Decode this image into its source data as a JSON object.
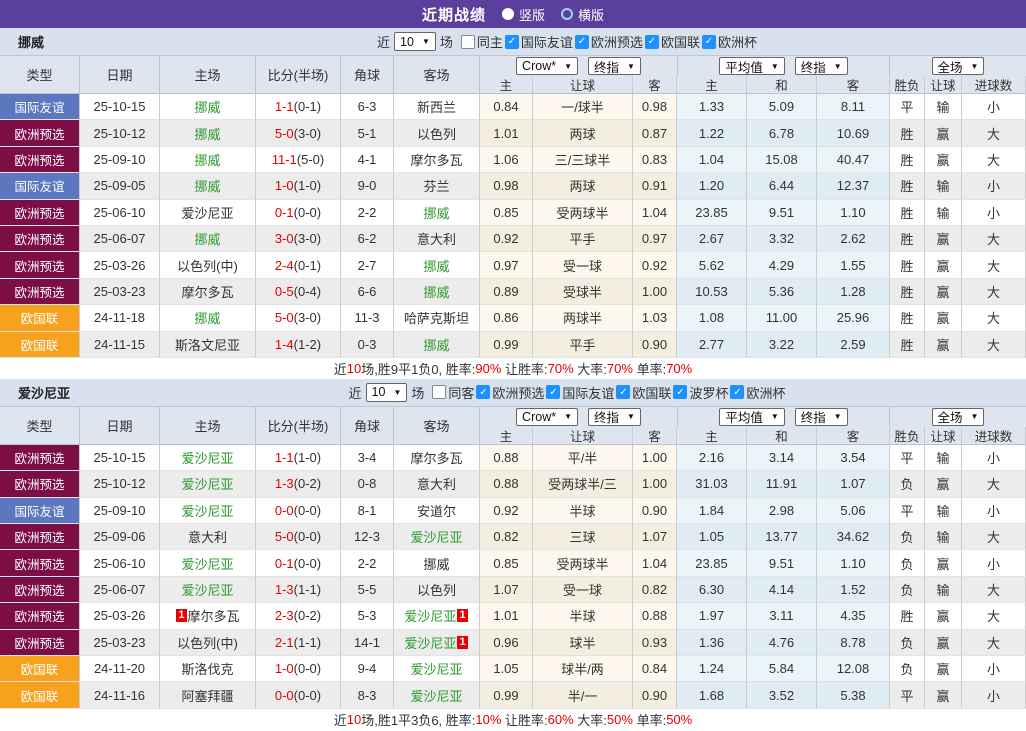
{
  "topbar": {
    "title": "近期战绩",
    "radios": [
      {
        "label": "竖版",
        "selected": true
      },
      {
        "label": "横版",
        "selected": false
      }
    ]
  },
  "thead": {
    "cols": [
      "类型",
      "日期",
      "主场",
      "比分(半场)",
      "角球",
      "客场"
    ],
    "sub": [
      "主",
      "让球",
      "客",
      "主",
      "和",
      "客",
      "胜负",
      "让球",
      "进球数"
    ],
    "dd": [
      "Crow*",
      "终指",
      "平均值",
      "终指",
      "全场"
    ]
  },
  "colors": {
    "accent_purple": "#5a3f9c",
    "type_friendly_blue": "#5a77c0",
    "type_qualifier_maroon": "#7c0d45",
    "type_nations_orange": "#f6a21d",
    "win_red": "#e00000",
    "draw_green": "#0f8a0f",
    "loss_blue": "#3232cc",
    "team_green": "#2f9a2f",
    "score_red": "#e60000"
  },
  "maps": {
    "type": {
      "国际友谊": "t-blue",
      "欧洲预选": "t-maroon",
      "欧国联": "t-orange"
    },
    "result": {
      "胜": "c-red",
      "平": "c-green",
      "负": "c-blue",
      "赢": "c-red",
      "输": "c-blue",
      "大": "c-red",
      "小": "c-blue"
    },
    "focusHome": {
      "home": "c-green2"
    },
    "focusAway": {
      "away": "c-green2"
    },
    "check": {
      "true": "on"
    },
    "radio": {
      "true": "on"
    },
    "seg": {
      "r": "s-red",
      "b": "s-blk"
    }
  },
  "sections": [
    {
      "team": "挪威",
      "filter": {
        "near": "近",
        "count": "10",
        "games": "场",
        "same": {
          "label": "同主",
          "checked": false
        },
        "comps": [
          {
            "label": "国际友谊",
            "checked": true
          },
          {
            "label": "欧洲预选",
            "checked": true
          },
          {
            "label": "欧国联",
            "checked": true
          },
          {
            "label": "欧洲杯",
            "checked": true
          }
        ]
      },
      "rows": [
        {
          "type": "国际友谊",
          "date": "25-10-15",
          "home": "挪威",
          "score": "1-1",
          "half": "(0-1)",
          "corners": "6-3",
          "away": "新西兰",
          "focus": "home",
          "h1": "0.84",
          "hcap": "一/球半",
          "h2": "0.98",
          "a1": "1.33",
          "a2": "5.09",
          "a3": "8.11",
          "wl": "平",
          "hc": "输",
          "ou": "小"
        },
        {
          "type": "欧洲预选",
          "date": "25-10-12",
          "home": "挪威",
          "score": "5-0",
          "half": "(3-0)",
          "corners": "5-1",
          "away": "以色列",
          "focus": "home",
          "h1": "1.01",
          "hcap": "两球",
          "h2": "0.87",
          "a1": "1.22",
          "a2": "6.78",
          "a3": "10.69",
          "wl": "胜",
          "hc": "赢",
          "ou": "大"
        },
        {
          "type": "欧洲预选",
          "date": "25-09-10",
          "home": "挪威",
          "score": "11-1",
          "half": "(5-0)",
          "corners": "4-1",
          "away": "摩尔多瓦",
          "focus": "home",
          "h1": "1.06",
          "hcap": "三/三球半",
          "h2": "0.83",
          "a1": "1.04",
          "a2": "15.08",
          "a3": "40.47",
          "wl": "胜",
          "hc": "赢",
          "ou": "大"
        },
        {
          "type": "国际友谊",
          "date": "25-09-05",
          "home": "挪威",
          "score": "1-0",
          "half": "(1-0)",
          "corners": "9-0",
          "away": "芬兰",
          "focus": "home",
          "h1": "0.98",
          "hcap": "两球",
          "h2": "0.91",
          "a1": "1.20",
          "a2": "6.44",
          "a3": "12.37",
          "wl": "胜",
          "hc": "输",
          "ou": "小"
        },
        {
          "type": "欧洲预选",
          "date": "25-06-10",
          "home": "爱沙尼亚",
          "score": "0-1",
          "half": "(0-0)",
          "corners": "2-2",
          "away": "挪威",
          "focus": "away",
          "h1": "0.85",
          "hcap": "受两球半",
          "h2": "1.04",
          "a1": "23.85",
          "a2": "9.51",
          "a3": "1.10",
          "wl": "胜",
          "hc": "输",
          "ou": "小"
        },
        {
          "type": "欧洲预选",
          "date": "25-06-07",
          "home": "挪威",
          "score": "3-0",
          "half": "(3-0)",
          "corners": "6-2",
          "away": "意大利",
          "focus": "home",
          "h1": "0.92",
          "hcap": "平手",
          "h2": "0.97",
          "a1": "2.67",
          "a2": "3.32",
          "a3": "2.62",
          "wl": "胜",
          "hc": "赢",
          "ou": "大"
        },
        {
          "type": "欧洲预选",
          "date": "25-03-26",
          "home": "以色列(中)",
          "score": "2-4",
          "half": "(0-1)",
          "corners": "2-7",
          "away": "挪威",
          "focus": "away",
          "h1": "0.97",
          "hcap": "受一球",
          "h2": "0.92",
          "a1": "5.62",
          "a2": "4.29",
          "a3": "1.55",
          "wl": "胜",
          "hc": "赢",
          "ou": "大"
        },
        {
          "type": "欧洲预选",
          "date": "25-03-23",
          "home": "摩尔多瓦",
          "score": "0-5",
          "half": "(0-4)",
          "corners": "6-6",
          "away": "挪威",
          "focus": "away",
          "h1": "0.89",
          "hcap": "受球半",
          "h2": "1.00",
          "a1": "10.53",
          "a2": "5.36",
          "a3": "1.28",
          "wl": "胜",
          "hc": "赢",
          "ou": "大"
        },
        {
          "type": "欧国联",
          "date": "24-11-18",
          "home": "挪威",
          "score": "5-0",
          "half": "(3-0)",
          "corners": "11-3",
          "away": "哈萨克斯坦",
          "focus": "home",
          "h1": "0.86",
          "hcap": "两球半",
          "h2": "1.03",
          "a1": "1.08",
          "a2": "11.00",
          "a3": "25.96",
          "wl": "胜",
          "hc": "赢",
          "ou": "大"
        },
        {
          "type": "欧国联",
          "date": "24-11-15",
          "home": "斯洛文尼亚",
          "score": "1-4",
          "half": "(1-2)",
          "corners": "0-3",
          "away": "挪威",
          "focus": "away",
          "h1": "0.99",
          "hcap": "平手",
          "h2": "0.90",
          "a1": "2.77",
          "a2": "3.22",
          "a3": "2.59",
          "wl": "胜",
          "hc": "赢",
          "ou": "大"
        }
      ],
      "summary": [
        {
          "t": "近",
          "c": "b"
        },
        {
          "t": "10",
          "c": "r"
        },
        {
          "t": "场,胜9平1负0, 胜率:",
          "c": "b"
        },
        {
          "t": "90%",
          "c": "r"
        },
        {
          "t": " 让胜率:",
          "c": "b"
        },
        {
          "t": "70%",
          "c": "r"
        },
        {
          "t": " 大率:",
          "c": "b"
        },
        {
          "t": "70%",
          "c": "r"
        },
        {
          "t": " 单率:",
          "c": "b"
        },
        {
          "t": "70%",
          "c": "r"
        }
      ]
    },
    {
      "team": "爱沙尼亚",
      "filter": {
        "near": "近",
        "count": "10",
        "games": "场",
        "same": {
          "label": "同客",
          "checked": false
        },
        "comps": [
          {
            "label": "欧洲预选",
            "checked": true
          },
          {
            "label": "国际友谊",
            "checked": true
          },
          {
            "label": "欧国联",
            "checked": true
          },
          {
            "label": "波罗杯",
            "checked": true
          },
          {
            "label": "欧洲杯",
            "checked": true
          }
        ]
      },
      "rows": [
        {
          "type": "欧洲预选",
          "date": "25-10-15",
          "home": "爱沙尼亚",
          "score": "1-1",
          "half": "(1-0)",
          "corners": "3-4",
          "away": "摩尔多瓦",
          "focus": "home",
          "h1": "0.88",
          "hcap": "平/半",
          "h2": "1.00",
          "a1": "2.16",
          "a2": "3.14",
          "a3": "3.54",
          "wl": "平",
          "hc": "输",
          "ou": "小"
        },
        {
          "type": "欧洲预选",
          "date": "25-10-12",
          "home": "爱沙尼亚",
          "score": "1-3",
          "half": "(0-2)",
          "corners": "0-8",
          "away": "意大利",
          "focus": "home",
          "h1": "0.88",
          "hcap": "受两球半/三",
          "h2": "1.00",
          "a1": "31.03",
          "a2": "11.91",
          "a3": "1.07",
          "wl": "负",
          "hc": "赢",
          "ou": "大"
        },
        {
          "type": "国际友谊",
          "date": "25-09-10",
          "home": "爱沙尼亚",
          "score": "0-0",
          "half": "(0-0)",
          "corners": "8-1",
          "away": "安道尔",
          "focus": "home",
          "h1": "0.92",
          "hcap": "半球",
          "h2": "0.90",
          "a1": "1.84",
          "a2": "2.98",
          "a3": "5.06",
          "wl": "平",
          "hc": "输",
          "ou": "小"
        },
        {
          "type": "欧洲预选",
          "date": "25-09-06",
          "home": "意大利",
          "score": "5-0",
          "half": "(0-0)",
          "corners": "12-3",
          "away": "爱沙尼亚",
          "focus": "away",
          "h1": "0.82",
          "hcap": "三球",
          "h2": "1.07",
          "a1": "1.05",
          "a2": "13.77",
          "a3": "34.62",
          "wl": "负",
          "hc": "输",
          "ou": "大"
        },
        {
          "type": "欧洲预选",
          "date": "25-06-10",
          "home": "爱沙尼亚",
          "score": "0-1",
          "half": "(0-0)",
          "corners": "2-2",
          "away": "挪威",
          "focus": "home",
          "h1": "0.85",
          "hcap": "受两球半",
          "h2": "1.04",
          "a1": "23.85",
          "a2": "9.51",
          "a3": "1.10",
          "wl": "负",
          "hc": "赢",
          "ou": "小"
        },
        {
          "type": "欧洲预选",
          "date": "25-06-07",
          "home": "爱沙尼亚",
          "score": "1-3",
          "half": "(1-1)",
          "corners": "5-5",
          "away": "以色列",
          "focus": "home",
          "h1": "1.07",
          "hcap": "受一球",
          "h2": "0.82",
          "a1": "6.30",
          "a2": "4.14",
          "a3": "1.52",
          "wl": "负",
          "hc": "输",
          "ou": "大"
        },
        {
          "type": "欧洲预选",
          "date": "25-03-26",
          "home": "摩尔多瓦",
          "home_rc": "1",
          "score": "2-3",
          "half": "(0-2)",
          "corners": "5-3",
          "away": "爱沙尼亚",
          "away_rc": "1",
          "focus": "away",
          "h1": "1.01",
          "hcap": "半球",
          "h2": "0.88",
          "a1": "1.97",
          "a2": "3.11",
          "a3": "4.35",
          "wl": "胜",
          "hc": "赢",
          "ou": "大"
        },
        {
          "type": "欧洲预选",
          "date": "25-03-23",
          "home": "以色列(中)",
          "score": "2-1",
          "half": "(1-1)",
          "corners": "14-1",
          "away": "爱沙尼亚",
          "away_rc": "1",
          "focus": "away",
          "h1": "0.96",
          "hcap": "球半",
          "h2": "0.93",
          "a1": "1.36",
          "a2": "4.76",
          "a3": "8.78",
          "wl": "负",
          "hc": "赢",
          "ou": "大"
        },
        {
          "type": "欧国联",
          "date": "24-11-20",
          "home": "斯洛伐克",
          "score": "1-0",
          "half": "(0-0)",
          "corners": "9-4",
          "away": "爱沙尼亚",
          "focus": "away",
          "h1": "1.05",
          "hcap": "球半/两",
          "h2": "0.84",
          "a1": "1.24",
          "a2": "5.84",
          "a3": "12.08",
          "wl": "负",
          "hc": "赢",
          "ou": "小"
        },
        {
          "type": "欧国联",
          "date": "24-11-16",
          "home": "阿塞拜疆",
          "score": "0-0",
          "half": "(0-0)",
          "corners": "8-3",
          "away": "爱沙尼亚",
          "focus": "away",
          "h1": "0.99",
          "hcap": "半/一",
          "h2": "0.90",
          "a1": "1.68",
          "a2": "3.52",
          "a3": "5.38",
          "wl": "平",
          "hc": "赢",
          "ou": "小"
        }
      ],
      "summary": [
        {
          "t": "近",
          "c": "b"
        },
        {
          "t": "10",
          "c": "r"
        },
        {
          "t": "场,胜1平3负6, 胜率:",
          "c": "b"
        },
        {
          "t": "10%",
          "c": "r"
        },
        {
          "t": " 让胜率:",
          "c": "b"
        },
        {
          "t": "60%",
          "c": "r"
        },
        {
          "t": " 大率:",
          "c": "b"
        },
        {
          "t": "50%",
          "c": "r"
        },
        {
          "t": " 单率:",
          "c": "b"
        },
        {
          "t": "50%",
          "c": "r"
        }
      ]
    }
  ]
}
